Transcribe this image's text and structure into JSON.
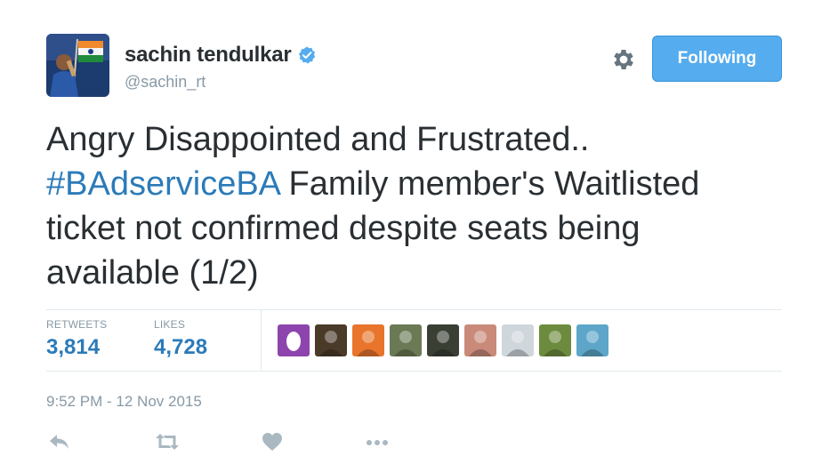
{
  "user": {
    "name": "sachin tendulkar",
    "handle": "@sachin_rt",
    "verified": true
  },
  "follow_button": {
    "label": "Following"
  },
  "tweet": {
    "line1": "Angry Disappointed and Frustrated..",
    "hashtag": "#BAdserviceBA",
    "line2_rest": " Family member's Waitlisted",
    "line3": "ticket not confirmed despite seats being",
    "line4": "available (1/2)"
  },
  "stats": {
    "retweets_label": "RETWEETS",
    "retweets_value": "3,814",
    "likes_label": "LIKES",
    "likes_value": "4,728"
  },
  "likers": [
    {
      "icon": "egg-avatar",
      "color": "#8e44ad"
    },
    {
      "icon": "user-avatar",
      "color": "#4a3a28"
    },
    {
      "icon": "user-avatar",
      "color": "#e8752b"
    },
    {
      "icon": "user-avatar",
      "color": "#6b7a55"
    },
    {
      "icon": "user-avatar",
      "color": "#3a3f34"
    },
    {
      "icon": "user-avatar",
      "color": "#c98a7a"
    },
    {
      "icon": "user-avatar",
      "color": "#cfd6dc"
    },
    {
      "icon": "user-avatar",
      "color": "#6d8b3e"
    },
    {
      "icon": "user-avatar",
      "color": "#5da6c9"
    }
  ],
  "timestamp": "9:52 PM - 12 Nov 2015",
  "colors": {
    "link_blue": "#2b7bb9",
    "button_blue": "#55acee",
    "muted_gray": "#8899a6",
    "verified_blue": "#55acee"
  }
}
